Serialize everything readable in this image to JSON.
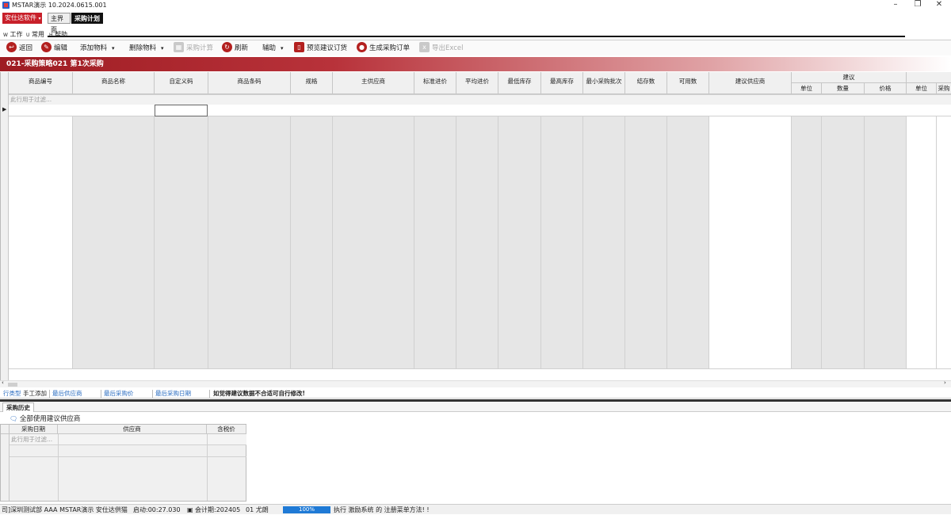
{
  "window": {
    "title": "MSTAR演示   10.2024.0615.001",
    "controls": [
      "–",
      "❐",
      "✕"
    ]
  },
  "app_menu": "安仕达软件",
  "tabs": [
    {
      "label": "主界面",
      "active": false
    },
    {
      "label": "采购计划",
      "active": true
    }
  ],
  "menu": [
    {
      "prefix": "W",
      "label": "工作"
    },
    {
      "prefix": "U",
      "label": "常用"
    },
    {
      "prefix": "H",
      "label": "帮助"
    }
  ],
  "toolbar": {
    "back": "返回",
    "edit": "编辑",
    "add_item": "添加物料",
    "delete_item": "删除物料",
    "purchase_calc": "采购计算",
    "refresh": "刷新",
    "assist": "辅助",
    "preview_order": "预览建议订货",
    "generate_order": "生成采购订单",
    "export_excel": "导出Excel"
  },
  "band_title": "021-采购策略021 第1次采购",
  "grid": {
    "columns": [
      "商品编号",
      "商品名称",
      "自定义码",
      "商品条码",
      "规格",
      "主供应商",
      "标准进价",
      "平均进价",
      "最低库存",
      "最高库存",
      "最小采购批次",
      "结存数",
      "可用数",
      "建议供应商"
    ],
    "group_header": "建议",
    "group_columns": [
      "单位",
      "数量",
      "价格"
    ],
    "extra_columns": [
      "单位",
      "采购"
    ],
    "filter_placeholder": "此行用于过滤..."
  },
  "info_strip": {
    "row_type_label": "行类型",
    "row_type_value": "手工添加",
    "last_supplier": "最后供应商",
    "last_price": "最后采购价",
    "last_date": "最后采购日期",
    "notice": "如觉得建议数据不合适可自行修改!"
  },
  "history": {
    "tab": "采购历史",
    "checkbox_label": "全部使用建议供应商",
    "columns": [
      "采购日期",
      "供应商",
      "含税价"
    ],
    "filter_placeholder": "此行用于过滤..."
  },
  "status": {
    "company": "司]深圳测试部 AAA MSTAR演示 安仕达供猫",
    "startup": "启动:00:27.030",
    "period": "会计期:202405",
    "user": "01 尤朗",
    "progress_percent": 100,
    "progress_text": "100%",
    "message": "执行 激励系统 的 注册菜单方法! !"
  }
}
